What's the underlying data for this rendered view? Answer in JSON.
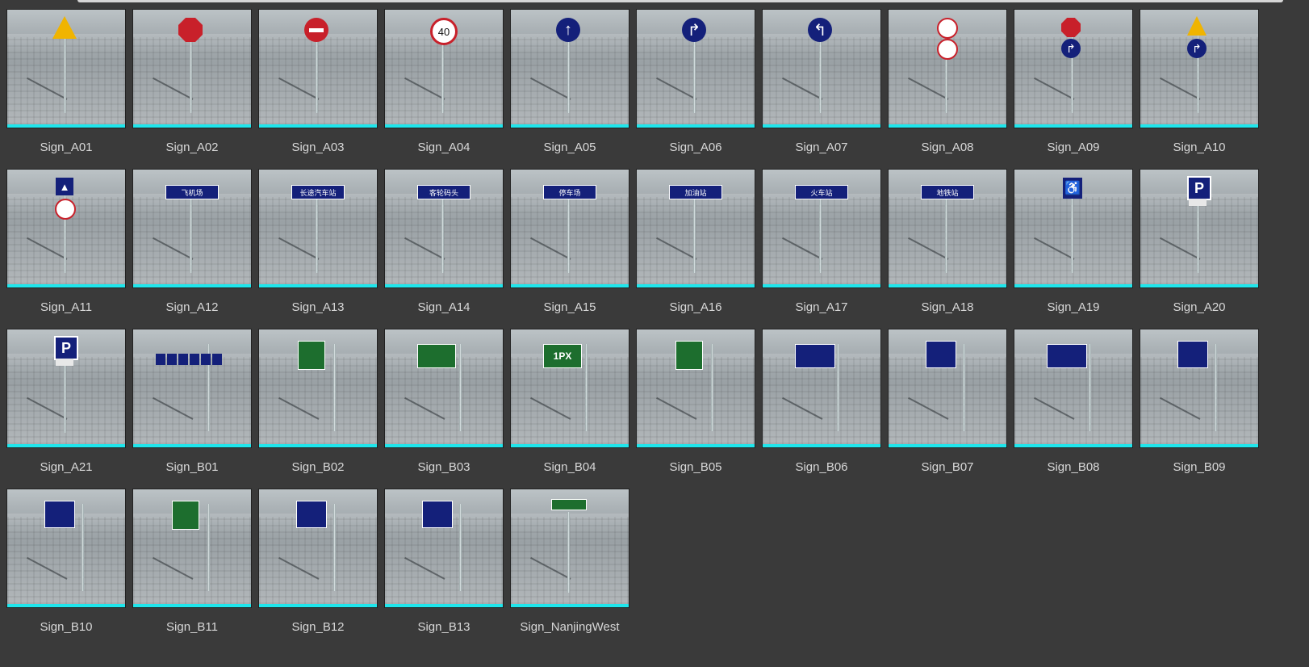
{
  "assets": [
    {
      "name": "Sign_A01",
      "sign": "warning-triangle"
    },
    {
      "name": "Sign_A02",
      "sign": "stop-octagon"
    },
    {
      "name": "Sign_A03",
      "sign": "no-entry"
    },
    {
      "name": "Sign_A04",
      "sign": "speed-limit-40",
      "text": "40"
    },
    {
      "name": "Sign_A05",
      "sign": "straight-arrow"
    },
    {
      "name": "Sign_A06",
      "sign": "straight-right-arrow"
    },
    {
      "name": "Sign_A07",
      "sign": "straight-left-arrow"
    },
    {
      "name": "Sign_A08",
      "sign": "prohibition-double"
    },
    {
      "name": "Sign_A09",
      "sign": "stop-and-turn"
    },
    {
      "name": "Sign_A10",
      "sign": "pedestrian-and-turn"
    },
    {
      "name": "Sign_A11",
      "sign": "crossing-prohibition"
    },
    {
      "name": "Sign_A12",
      "sign": "direction-panel",
      "text": "飞机场"
    },
    {
      "name": "Sign_A13",
      "sign": "direction-panel",
      "text": "长途汽车站"
    },
    {
      "name": "Sign_A14",
      "sign": "direction-panel",
      "text": "客轮码头"
    },
    {
      "name": "Sign_A15",
      "sign": "direction-panel",
      "text": "停车场"
    },
    {
      "name": "Sign_A16",
      "sign": "direction-panel",
      "text": "加油站"
    },
    {
      "name": "Sign_A17",
      "sign": "direction-panel",
      "text": "火车站"
    },
    {
      "name": "Sign_A18",
      "sign": "direction-panel",
      "text": "地铁站"
    },
    {
      "name": "Sign_A19",
      "sign": "accessible-square"
    },
    {
      "name": "Sign_A20",
      "sign": "parking-square",
      "text": "P"
    },
    {
      "name": "Sign_A21",
      "sign": "parking-square",
      "text": "P"
    },
    {
      "name": "Sign_B01",
      "sign": "gantry-blue-row"
    },
    {
      "name": "Sign_B02",
      "sign": "gantry-green"
    },
    {
      "name": "Sign_B03",
      "sign": "gantry-green-wide"
    },
    {
      "name": "Sign_B04",
      "sign": "gantry-green-wide",
      "text": "1PX"
    },
    {
      "name": "Sign_B05",
      "sign": "gantry-green"
    },
    {
      "name": "Sign_B06",
      "sign": "gantry-blue-wide"
    },
    {
      "name": "Sign_B07",
      "sign": "gantry-blue"
    },
    {
      "name": "Sign_B08",
      "sign": "gantry-blue-wide"
    },
    {
      "name": "Sign_B09",
      "sign": "gantry-blue"
    },
    {
      "name": "Sign_B10",
      "sign": "gantry-blue"
    },
    {
      "name": "Sign_B11",
      "sign": "gantry-green"
    },
    {
      "name": "Sign_B12",
      "sign": "gantry-blue"
    },
    {
      "name": "Sign_B13",
      "sign": "gantry-blue"
    },
    {
      "name": "Sign_NanjingWest",
      "sign": "street-name-green"
    }
  ],
  "colors": {
    "accent_underline": "#1fe6ec",
    "background": "#3a3a3a",
    "label": "#d8d8d8"
  }
}
